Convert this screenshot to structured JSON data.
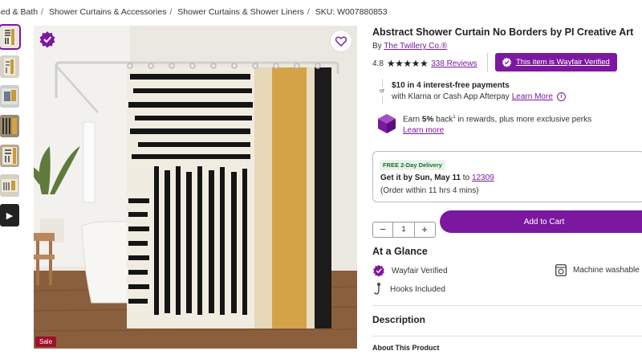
{
  "breadcrumb": [
    "Bed & Bath",
    "Shower Curtains & Accessories",
    "Shower Curtains & Shower Liners"
  ],
  "sku": "SKU: W007880853",
  "gallery": {
    "thumbnails": [
      "image-1",
      "image-2",
      "image-3",
      "image-4",
      "image-5",
      "image-6",
      "video"
    ],
    "sale_label": "Sale"
  },
  "product": {
    "title": "Abstract Shower Curtain No Borders by PI Creative Art",
    "by_prefix": "By",
    "brand": "The Twillery Co.®",
    "rating": "4.8",
    "stars": "★★★★★",
    "reviews": "338 Reviews",
    "verified_label": "This item is Wayfair Verified"
  },
  "payments": {
    "or": "or",
    "line1": "$10 in 4 interest-free payments",
    "line2": "with Klarna or Cash App Afterpay",
    "learn_more": "Learn More"
  },
  "rewards": {
    "earn_prefix": "Earn ",
    "percent": "5%",
    "suffix_a": " back",
    "superscript": "1",
    "suffix_b": " in rewards, plus more exclusive perks",
    "learn_more": "Learn more"
  },
  "delivery": {
    "badge": "FREE 2-Day Delivery",
    "get_it": "Get it by Sun, May 11",
    "to": " to ",
    "zip": "12309",
    "order_within": "(Order within 11 hrs 4 mins)"
  },
  "cart": {
    "quantity": "1",
    "minus": "−",
    "plus": "+",
    "add_label": "Add to Cart"
  },
  "glance": {
    "title": "At a Glance",
    "verified": "Wayfair Verified",
    "machine_washable": "Machine washable",
    "hooks": "Hooks Included"
  },
  "description": {
    "title": "Description",
    "about": "About This Product"
  },
  "colors": {
    "accent": "#7b189f",
    "sale": "#a0102a",
    "delivery_badge_bg": "#e8f4ea"
  }
}
